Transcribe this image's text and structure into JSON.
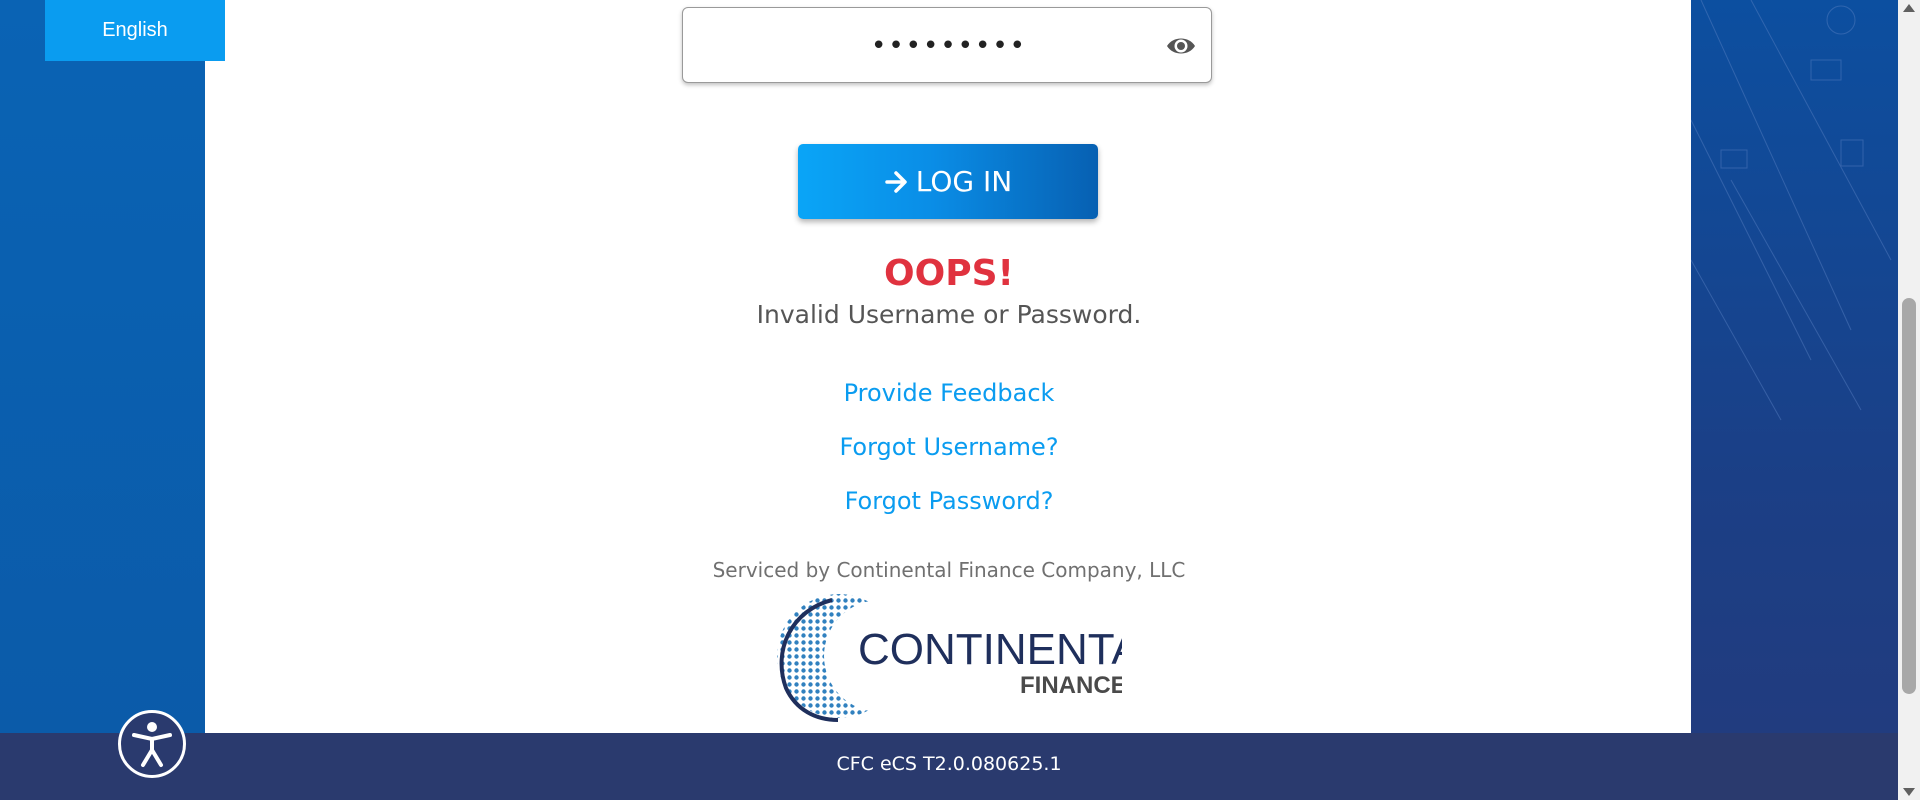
{
  "language": {
    "label": "English"
  },
  "login": {
    "password_value": "•••••••••",
    "button_label": "LOG IN"
  },
  "error": {
    "title": "OOPS!",
    "message": "Invalid Username or Password."
  },
  "links": {
    "feedback": "Provide Feedback",
    "forgot_username": "Forgot Username?",
    "forgot_password": "Forgot Password?"
  },
  "serviced_by": "Serviced by Continental Finance Company, LLC",
  "logo": {
    "word1": "CONTINENTAL",
    "word2": "FINANCE"
  },
  "footer": {
    "version": "CFC eCS T2.0.080625.1"
  },
  "colors": {
    "accent": "#0a9cf0",
    "error": "#e0323f",
    "footer": "#2a3a6e",
    "logo_navy": "#1f2f5c"
  },
  "icons": {
    "eye": "eye-icon",
    "arrow": "arrow-right-icon",
    "accessibility": "accessibility-icon"
  }
}
